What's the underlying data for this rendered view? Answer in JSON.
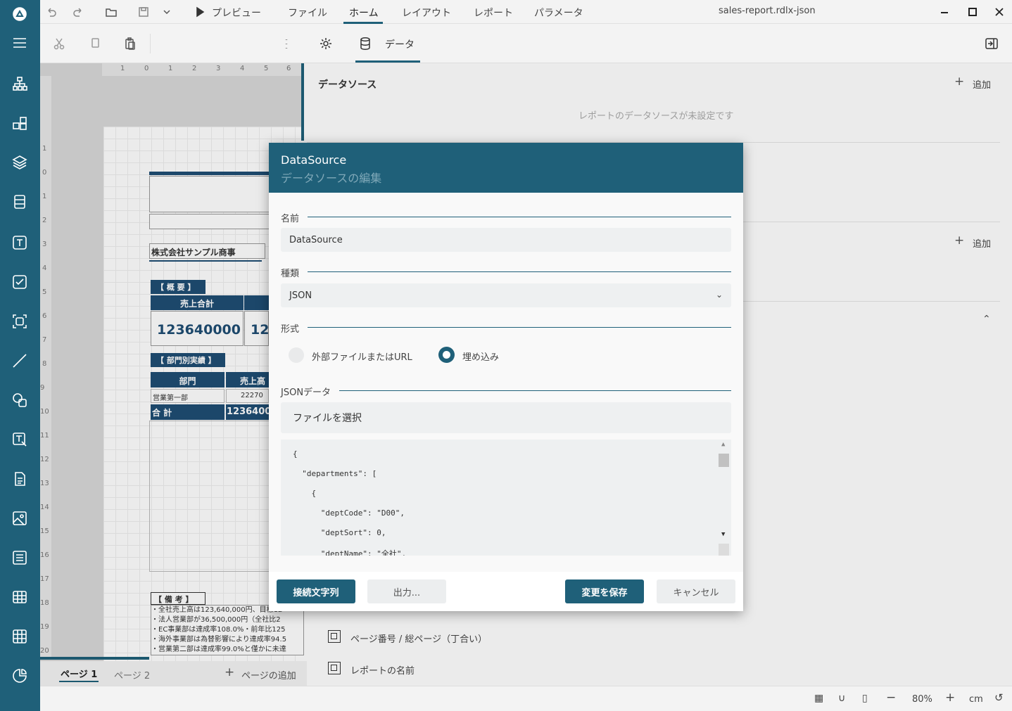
{
  "window": {
    "title": "sales-report.rdlx-json",
    "menus": [
      "プレビュー",
      "ファイル",
      "ホーム",
      "レイアウト",
      "レポート",
      "パラメータ"
    ],
    "active_menu": "ホーム"
  },
  "toolbar": {
    "data_tab_label": "データ"
  },
  "ruler": {
    "h_ticks": [
      "1",
      "0",
      "1",
      "2",
      "3",
      "4",
      "5",
      "6"
    ],
    "v_ticks": [
      "1",
      "0",
      "1",
      "2",
      "3",
      "4",
      "5",
      "6",
      "7",
      "8",
      "9",
      "10",
      "11",
      "12",
      "13",
      "14",
      "15",
      "16",
      "17",
      "18",
      "19",
      "20"
    ]
  },
  "report": {
    "company": "株式会社サンプル商事",
    "summary_header": "【 概 要 】",
    "sales_total_label": "売上合計",
    "sales_total_value": "123640000",
    "sales_total_value2": "12",
    "dept_header": "【 部門別実績 】",
    "col_dept": "部門",
    "col_sales": "売上高",
    "row1_dept": "営業第一部",
    "row1_sales": "22270",
    "total_label": "合 計",
    "total_value": "1236400",
    "notes_header": "【 備 考 】",
    "notes": [
      "・全社売上高は123,640,000円、目標12",
      "・法人営業部が36,500,000円（全社比2",
      "・EC事業部は達成率108.0%・前年比125",
      "・海外事業部は為替影響により達成率94.5",
      "・営業第二部は達成率99.0%と僅かに未達"
    ]
  },
  "pages": {
    "page1": "ページ 1",
    "page2": "ページ 2",
    "add_page": "ページの追加"
  },
  "right_panel": {
    "datasource_title": "データソース",
    "add_label": "追加",
    "add_label2": "追加",
    "empty_message": "レポートのデータソースが未設定です",
    "items": [
      "ページ番号 / 総ページ（丁合い）",
      "レポートの名前"
    ]
  },
  "dialog": {
    "title": "DataSource",
    "subtitle": "データソースの編集",
    "name_label": "名前",
    "name_value": "DataSource",
    "type_label": "種類",
    "type_value": "JSON",
    "format_label": "形式",
    "format_option_external": "外部ファイルまたはURL",
    "format_option_embedded": "埋め込み",
    "format_selected": "埋め込み",
    "json_label": "JSONデータ",
    "file_select": "ファイルを選択",
    "json_lines": [
      "{",
      "  \"departments\": [",
      "    {",
      "      \"deptCode\": \"D00\",",
      "      \"deptSort\": 0,",
      "      \"deptName\": \"全社\","
    ],
    "btn_connection": "接続文字列",
    "btn_export": "出力...",
    "btn_save": "変更を保存",
    "btn_cancel": "キャンセル"
  },
  "status": {
    "zoom": "80%",
    "unit": "cm"
  }
}
